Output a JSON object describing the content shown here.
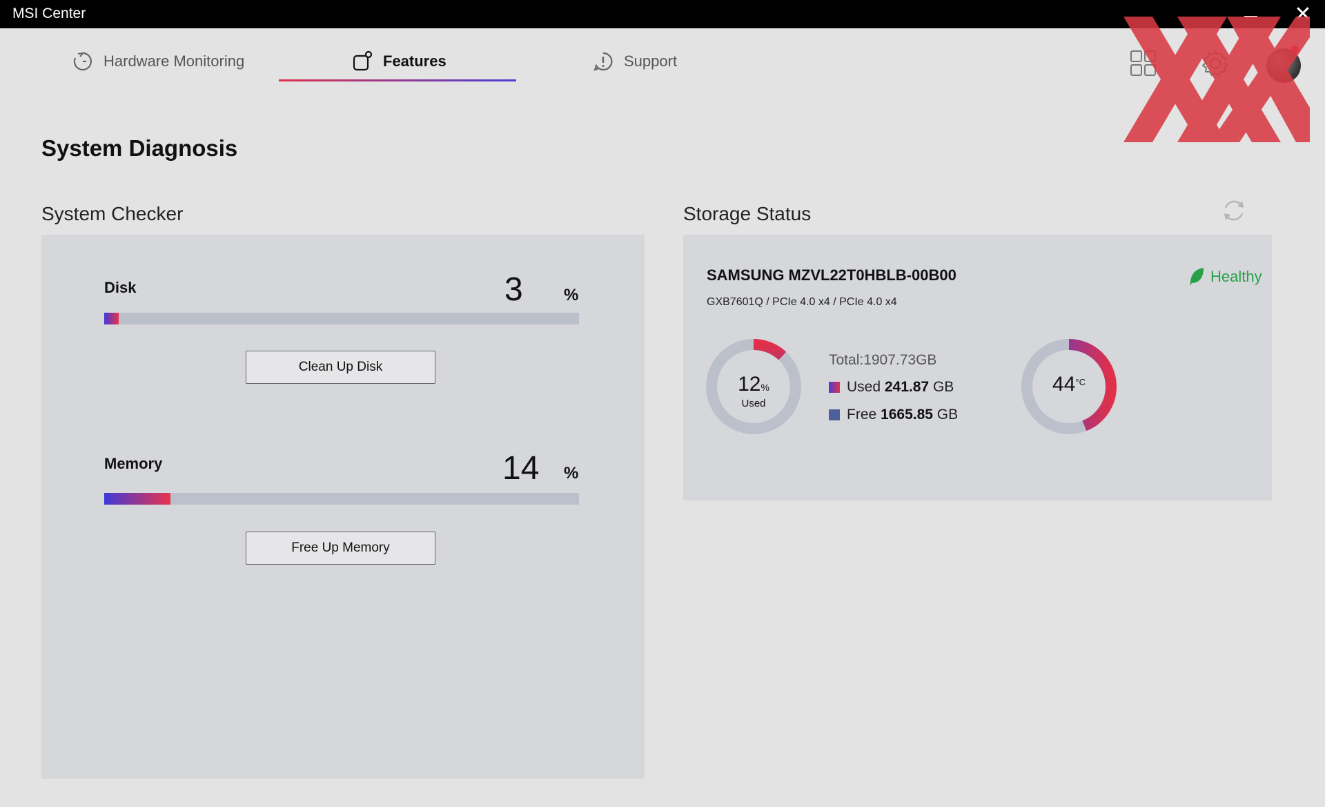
{
  "window": {
    "title": "MSI Center",
    "minimize_label": "—",
    "close_label": "✕"
  },
  "tabs": [
    {
      "label": "Hardware Monitoring",
      "icon": "gauge-icon",
      "active": false
    },
    {
      "label": "Features",
      "icon": "features-icon",
      "active": true
    },
    {
      "label": "Support",
      "icon": "support-icon",
      "active": false
    }
  ],
  "header_icons": [
    "apps-grid-icon",
    "gear-icon",
    "avatar"
  ],
  "page": {
    "title": "System Diagnosis"
  },
  "system_checker": {
    "title": "System Checker",
    "disk": {
      "label": "Disk",
      "value": "3",
      "unit": "%",
      "button": "Clean Up Disk",
      "percent": 3
    },
    "memory": {
      "label": "Memory",
      "value": "14",
      "unit": "%",
      "button": "Free Up Memory",
      "percent": 14
    }
  },
  "storage_status": {
    "title": "Storage Status",
    "drive_name": "SAMSUNG MZVL22T0HBLB-00B00",
    "drive_spec": "GXB7601Q / PCIe 4.0 x4 / PCIe 4.0 x4",
    "health": "Healthy",
    "usage": {
      "percent": "12",
      "unit": "%",
      "sub": "Used",
      "fraction": 0.12
    },
    "total": "Total:1907.73GB",
    "used": {
      "label": "Used",
      "value": "241.87",
      "unit": "GB"
    },
    "free": {
      "label": "Free",
      "value": "1665.85",
      "unit": "GB"
    },
    "temperature": {
      "value": "44",
      "unit": "°C",
      "fraction": 0.44
    }
  },
  "colors": {
    "accent_red": "#e0304a",
    "accent_blue": "#4a3fd6",
    "healthy_green": "#27a047",
    "ring_track": "#bcc0ca"
  }
}
